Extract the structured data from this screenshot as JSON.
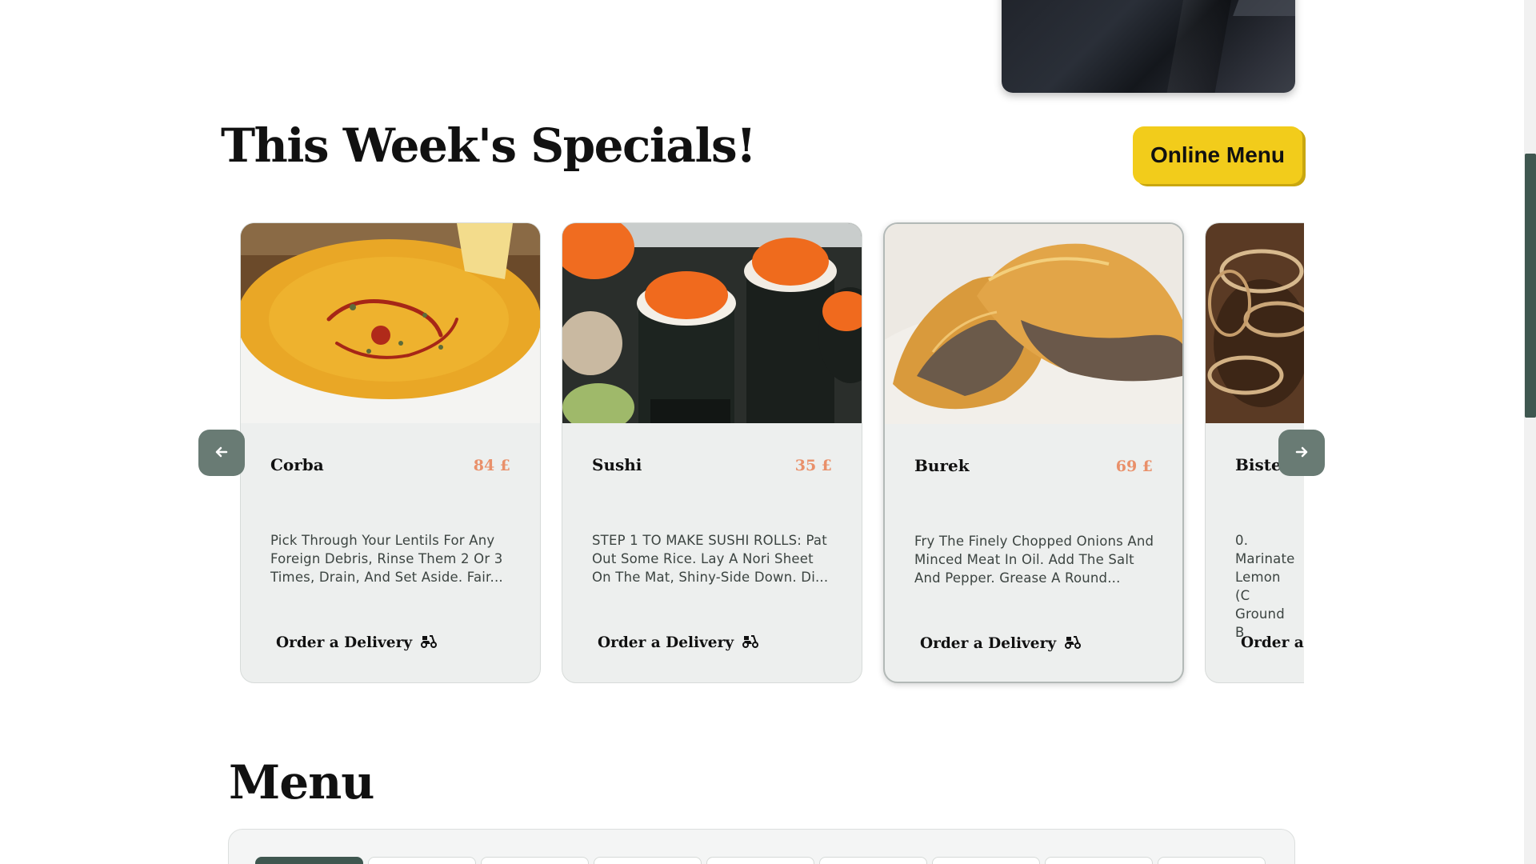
{
  "specials": {
    "title": "This Week's Specials!",
    "online_menu_label": "Online Menu",
    "order_label": "Order a Delivery",
    "cards": [
      {
        "name": "Corba",
        "price": "84 £",
        "description": "Pick Through Your Lentils For Any Foreign Debris, Rinse Them 2 Or 3 Times, Drain, And Set Aside. Fair...",
        "image": "lentil-soup"
      },
      {
        "name": "Sushi",
        "price": "35 £",
        "description": "STEP 1 TO MAKE SUSHI ROLLS: Pat Out Some Rice. Lay A Nori Sheet On The Mat, Shiny-Side Down. Di...",
        "image": "sushi-rolls"
      },
      {
        "name": "Burek",
        "price": "69 £",
        "description": "Fry The Finely Chopped Onions And Minced Meat In Oil. Add The Salt And Pepper. Grease A Round...",
        "image": "burek-pastry"
      },
      {
        "name": "Bistek",
        "price": "",
        "description": "0. Marinate Lemon (C Ground B",
        "image": "bistek-onions"
      }
    ]
  },
  "menu": {
    "title": "Menu",
    "tab_count": 10
  },
  "colors": {
    "accent_yellow": "#f2cc1b",
    "price_orange": "#e9906a",
    "arrow_green": "#697b74",
    "dark_green": "#3f5750",
    "card_bg": "#edefee"
  },
  "icons": {
    "prev": "arrow-left-icon",
    "next": "arrow-right-icon",
    "delivery": "scooter-icon"
  }
}
